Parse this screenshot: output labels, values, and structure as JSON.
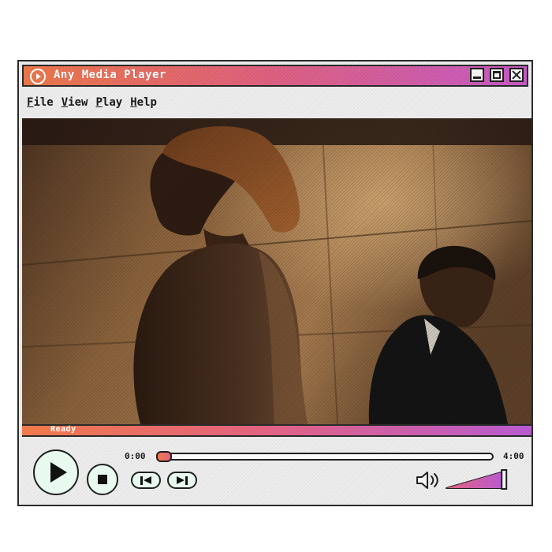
{
  "window": {
    "title": "Any Media Player",
    "app_icon": "play-circle-icon",
    "controls": [
      "minimize-icon",
      "maximize-icon",
      "close-icon"
    ]
  },
  "menu": {
    "items": [
      {
        "label": "File"
      },
      {
        "label": "View"
      },
      {
        "label": "Play"
      },
      {
        "label": "Help"
      }
    ]
  },
  "status": {
    "text": "Ready"
  },
  "playback": {
    "current_time": "0:00",
    "total_time": "4:00",
    "progress_fraction": 0.0,
    "volume_fraction": 0.95
  },
  "icons": {
    "play": "play-icon",
    "stop": "stop-icon",
    "previous": "skip-previous-icon",
    "next": "skip-next-icon",
    "volume": "speaker-icon"
  },
  "colors": {
    "accent_orange": "#f07a4a",
    "accent_pink": "#e4637e",
    "accent_purple": "#c95cc8",
    "button_fill": "#e8faef",
    "outline": "#1f1f1f"
  }
}
